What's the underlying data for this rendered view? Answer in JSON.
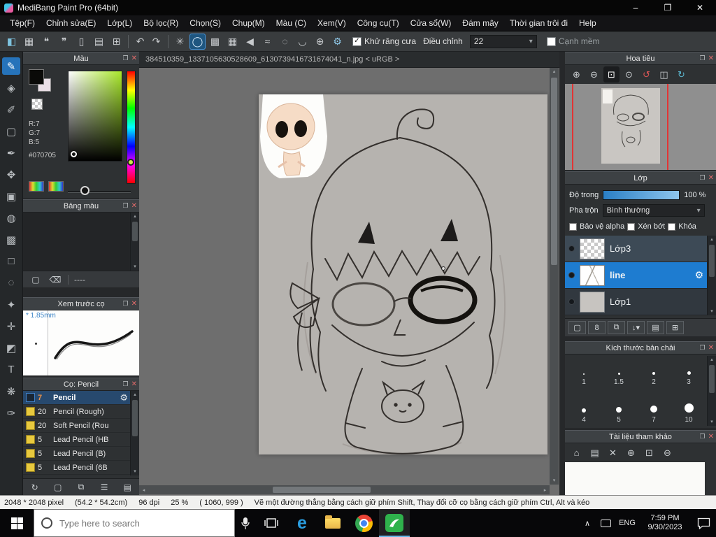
{
  "window": {
    "title": "MediBang Paint Pro (64bit)",
    "minimize": "–",
    "maximize": "❐",
    "close": "✕"
  },
  "icons": {
    "popout": "❐",
    "close": "✕",
    "check": "✓",
    "caret": "▾",
    "scroll_up": "▴",
    "scroll_down": "▾",
    "scroll_left": "◂",
    "scroll_right": "▸",
    "gear": "⚙",
    "tray_up": "∧"
  },
  "menubar": {
    "items": [
      "Tệp(F)",
      "Chỉnh sửa(E)",
      "Lớp(L)",
      "Bộ lọc(R)",
      "Chọn(S)",
      "Chụp(M)",
      "Màu (C)",
      "Xem(V)",
      "Công cụ(T)",
      "Cửa sổ(W)",
      "Đám mây",
      "Thời gian trôi đi",
      "Help"
    ]
  },
  "toolbar": {
    "file_icons": [
      {
        "name": "color-window-icon",
        "glyph": "◧",
        "color": "#7ec3e0"
      },
      {
        "name": "save-icon",
        "glyph": "▦"
      },
      {
        "name": "comment-icon",
        "glyph": "❝"
      },
      {
        "name": "chat-icon",
        "glyph": "❞"
      },
      {
        "name": "document-icon",
        "glyph": "▯"
      },
      {
        "name": "table-icon",
        "glyph": "▤"
      },
      {
        "name": "workspace-icon",
        "glyph": "⊞"
      }
    ],
    "undo_glyph": "↶",
    "redo_glyph": "↷",
    "brush_mode_icons": [
      {
        "name": "spinner-icon",
        "glyph": "✳"
      },
      {
        "name": "stroke-circle-icon",
        "glyph": "◯",
        "selected": true
      },
      {
        "name": "gradient-icon",
        "glyph": "▩"
      },
      {
        "name": "halftone-icon",
        "glyph": "▦"
      },
      {
        "name": "triangle-icon",
        "glyph": "◀"
      },
      {
        "name": "zigzag-icon",
        "glyph": "≈"
      },
      {
        "name": "dashed-circle-icon",
        "glyph": "◌"
      },
      {
        "name": "curve-icon",
        "glyph": "◡"
      },
      {
        "name": "crosshair-icon",
        "glyph": "⊕"
      },
      {
        "name": "settings-gear-icon",
        "glyph": "⚙",
        "color": "#8fc8e8"
      }
    ],
    "antialias_label": "Khử răng cưa",
    "antialias_checked": true,
    "adjust_label": "Điều chỉnh",
    "adjust_value": "22",
    "soft_edge_label": "Cạnh mềm",
    "soft_edge_checked": false
  },
  "tools": [
    {
      "name": "brush-tool",
      "glyph": "✎",
      "selected": true
    },
    {
      "name": "eraser-tool",
      "glyph": "◈"
    },
    {
      "name": "smudge-tool",
      "glyph": "✐"
    },
    {
      "name": "frame-tool",
      "glyph": "▢"
    },
    {
      "name": "control-tool",
      "glyph": "✒"
    },
    {
      "name": "move-tool",
      "glyph": "✥"
    },
    {
      "name": "shape-brush-tool",
      "glyph": "▣"
    },
    {
      "name": "bucket-tool",
      "glyph": "◍"
    },
    {
      "name": "gradient-tool",
      "glyph": "▩"
    },
    {
      "name": "select-rect-tool",
      "glyph": "□"
    },
    {
      "name": "lasso-tool",
      "glyph": "◌"
    },
    {
      "name": "magic-wand-tool",
      "glyph": "✦"
    },
    {
      "name": "select-pen-tool",
      "glyph": "✛"
    },
    {
      "name": "select-eraser-tool",
      "glyph": "◩"
    },
    {
      "name": "text-tool",
      "glyph": "T"
    },
    {
      "name": "hand-tool",
      "glyph": "❋"
    },
    {
      "name": "eyedropper-tool",
      "glyph": "✑"
    }
  ],
  "color_panel": {
    "title": "Màu",
    "r": "R:7",
    "g": "G:7",
    "b": "B:5",
    "hex": "#070705"
  },
  "palette_panel": {
    "title": "Bảng màu",
    "add_glyph": "▢",
    "trash_glyph": "⌫",
    "name_label": "----"
  },
  "brush_preview": {
    "title": "Xem trước cọ",
    "size": "* 1.85mm"
  },
  "brushes": {
    "title": "Cọ: Pencil",
    "items": [
      {
        "size": "7",
        "name": "Pencil",
        "selected": true
      },
      {
        "size": "20",
        "name": "Pencil (Rough)"
      },
      {
        "size": "20",
        "name": "Soft Pencil (Rou"
      },
      {
        "size": "5",
        "name": "Lead Pencil (HB"
      },
      {
        "size": "5",
        "name": "Lead Pencil (B)"
      },
      {
        "size": "5",
        "name": "Lead Pencil (6B"
      }
    ],
    "bottom_icons": [
      {
        "name": "sync-brush-icon",
        "glyph": "↻"
      },
      {
        "name": "add-brush-icon",
        "glyph": "▢"
      },
      {
        "name": "duplicate-brush-icon",
        "glyph": "⧉"
      },
      {
        "name": "brush-menu-icon",
        "glyph": "☰"
      },
      {
        "name": "brush-folder-icon",
        "glyph": "▤"
      }
    ]
  },
  "canvas": {
    "tab_title": "384510359_1337105630528609_6130739416731674041_n.jpg < uRGB >"
  },
  "navigator": {
    "title": "Hoa tiêu",
    "icons": [
      {
        "name": "zoom-in-icon",
        "glyph": "⊕"
      },
      {
        "name": "zoom-out-icon",
        "glyph": "⊖"
      },
      {
        "name": "fit-window-icon",
        "glyph": "⊡",
        "selected": true
      },
      {
        "name": "zoom-100-icon",
        "glyph": "⊙"
      },
      {
        "name": "rotate-ccw-icon",
        "glyph": "↺",
        "color": "#d85555"
      },
      {
        "name": "flip-icon",
        "glyph": "◫"
      },
      {
        "name": "rotate-reset-icon",
        "glyph": "↻",
        "color": "#5ab4cc"
      }
    ]
  },
  "layers": {
    "title": "Lớp",
    "opacity_label": "Độ trong",
    "opacity_value": "100 %",
    "blend_label": "Pha trộn",
    "blend_value": "Bình thường",
    "protect_alpha": "Bảo vệ alpha",
    "clipping": "Xén bớt",
    "lock": "Khóa",
    "items": [
      {
        "name": "Lớp3"
      },
      {
        "name": "line",
        "selected": true
      },
      {
        "name": "Lớp1"
      }
    ],
    "buttons": [
      {
        "name": "add-layer-icon",
        "glyph": "▢"
      },
      {
        "name": "add-8bit-layer-icon",
        "glyph": "8"
      },
      {
        "name": "duplicate-layer-icon",
        "glyph": "⧉"
      },
      {
        "name": "transfer-layer-icon",
        "glyph": "↓▾"
      },
      {
        "name": "layer-folder-icon",
        "glyph": "▤"
      },
      {
        "name": "merge-layer-icon",
        "glyph": "⊞"
      }
    ]
  },
  "brush_sizes": {
    "title": "Kích thước bản chải",
    "items": [
      {
        "label": "1",
        "dot": 2
      },
      {
        "label": "1.5",
        "dot": 3
      },
      {
        "label": "2",
        "dot": 4
      },
      {
        "label": "3",
        "dot": 5
      },
      {
        "label": "4",
        "dot": 6
      },
      {
        "label": "5",
        "dot": 8
      },
      {
        "label": "7",
        "dot": 10
      },
      {
        "label": "10",
        "dot": 13
      }
    ]
  },
  "reference": {
    "title": "Tài liệu tham khảo",
    "icons": [
      {
        "name": "home-icon",
        "glyph": "⌂"
      },
      {
        "name": "ref-folder-icon",
        "glyph": "▤"
      },
      {
        "name": "ref-close-icon",
        "glyph": "✕"
      },
      {
        "name": "ref-zoom-in-icon",
        "glyph": "⊕"
      },
      {
        "name": "ref-fit-icon",
        "glyph": "⊡"
      },
      {
        "name": "ref-zoom-out-icon",
        "glyph": "⊖"
      }
    ]
  },
  "statusbar": {
    "parts": [
      "2048 * 2048 pixel",
      "(54.2 * 54.2cm)",
      "96 dpi",
      "25 %",
      "( 1060, 999 )",
      "Vẽ một đường thẳng bằng cách giữ phím Shift, Thay đổi cỡ cọ bằng cách giữ phím Ctrl, Alt và kéo"
    ]
  },
  "taskbar": {
    "search_placeholder": "Type here to search",
    "edge_glyph": "e",
    "language": "ENG",
    "time": "7:59 PM",
    "date": "9/30/2023"
  }
}
